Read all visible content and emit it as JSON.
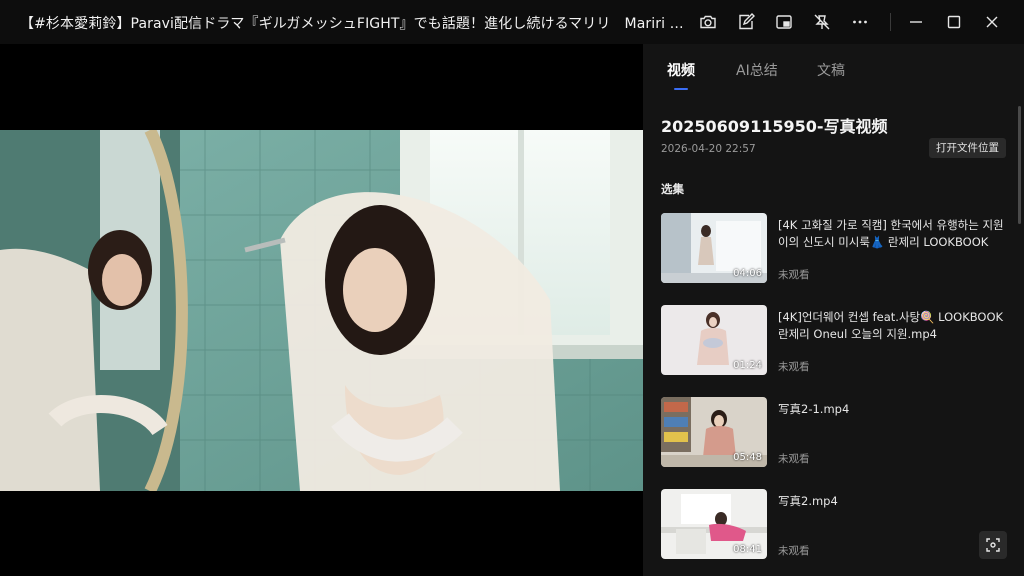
{
  "window": {
    "title": "【#杉本愛莉鈴】Paravi配信ドラマ『ギルガメッシュFIGHT』でも話題！進化し続けるマリリ　Mariri Sugimoto"
  },
  "toolbar": {
    "icons": [
      "camera-icon",
      "edit-note-icon",
      "picture-in-picture-icon",
      "pin-off-icon",
      "more-icon"
    ],
    "window_controls": [
      "minimize-icon",
      "maximize-icon",
      "close-icon"
    ]
  },
  "tabs": [
    {
      "label": "视频",
      "active": true
    },
    {
      "label": "AI总结",
      "active": false
    },
    {
      "label": "文稿",
      "active": false
    }
  ],
  "video": {
    "title": "20250609115950-写真视频",
    "date": "2026-04-20 22:57",
    "open_folder_label": "打开文件位置"
  },
  "episodes_label": "选集",
  "episodes": [
    {
      "title": "[4K 고화질 가로 직캠] 한국에서 유행하는 지원이의 신도시 미시룩👗  란제리 LOOKBOOK",
      "duration": "04:06",
      "status": "未观看"
    },
    {
      "title": "[4K]언더웨어 컨셉 feat.사탕🍭  LOOKBOOK 란제리 Oneul 오늘의 지원.mp4",
      "duration": "01:24",
      "status": "未观看"
    },
    {
      "title": "写真2-1.mp4",
      "duration": "05:48",
      "status": "未观看"
    },
    {
      "title": "写真2.mp4",
      "duration": "08:41",
      "status": "未观看"
    }
  ],
  "colors": {
    "accent": "#3b6ef5",
    "sidebar_bg": "#141414",
    "titlebar_bg": "#0d0d0d"
  }
}
